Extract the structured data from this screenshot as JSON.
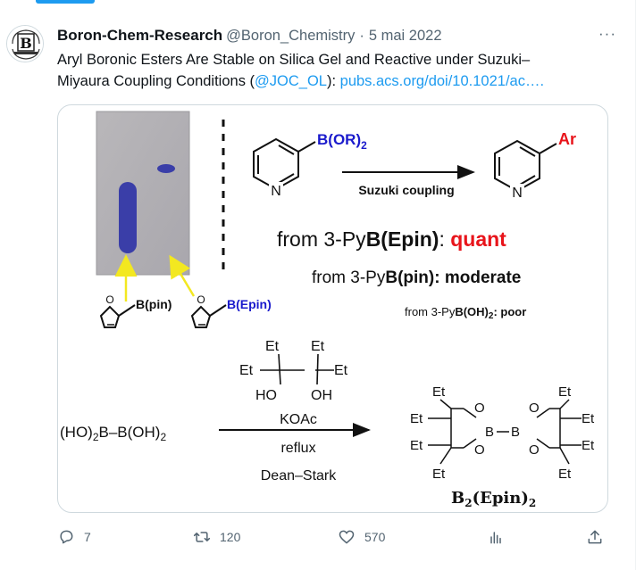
{
  "tweet": {
    "author_name": "Boron-Chem-Research",
    "handle": "@Boron_Chemistry",
    "separator": "·",
    "date": "5 mai 2022",
    "avatar_letter": "B",
    "more_label": "···",
    "text_line1": "Aryl Boronic Esters Are Stable on Silica Gel and Reactive under Suzuki–",
    "text_line2_pre": "Miyaura Coupling Conditions (",
    "mention": "@JOC_OL",
    "text_line2_post": "): ",
    "url": "pubs.acs.org/doi/10.1021/ac…."
  },
  "figure": {
    "top_substituent": "B(OR)",
    "top_substituent_sub": "2",
    "ring_n": "N",
    "arrow_label": "Suzuki coupling",
    "product_substituent": "Ar",
    "line1_pre": "from 3-Py",
    "line1_bold": "B(Epin)",
    "line1_colon": ": ",
    "line1_result": "quant",
    "line2_pre": "from 3-Py",
    "line2_bold": "B(pin)",
    "line2_post": ": moderate",
    "line3_pre": "from 3-Py",
    "line3_bold": "B(OH)",
    "line3_sub": "2",
    "line3_post": ": poor",
    "furan_label1": "B(pin)",
    "furan_label2": "B(Epin)",
    "furan_o": "O",
    "reagent_et": "Et",
    "reagent_ho": "HO",
    "reagent_oh": "OH",
    "reagent_koac": "KOAc",
    "reagent_reflux": "reflux",
    "reagent_deanstark": "Dean–Stark",
    "start_pre": "(HO)",
    "start_sub": "2",
    "start_post": "B–B(OH)",
    "start_sub2": "2",
    "product_b": "B",
    "product_o": "O",
    "product_et": "Et",
    "product_label": "B",
    "product_label_sub1": "2",
    "product_label_mid": "(Epin)",
    "product_label_sub2": "2"
  },
  "actions": {
    "replies": "7",
    "retweets": "120",
    "likes": "570"
  },
  "colors": {
    "accent": "#1d9bf0",
    "red": "#e8141b",
    "blue_text": "#1a1acc",
    "tlc_spot": "#3a3ea8"
  }
}
